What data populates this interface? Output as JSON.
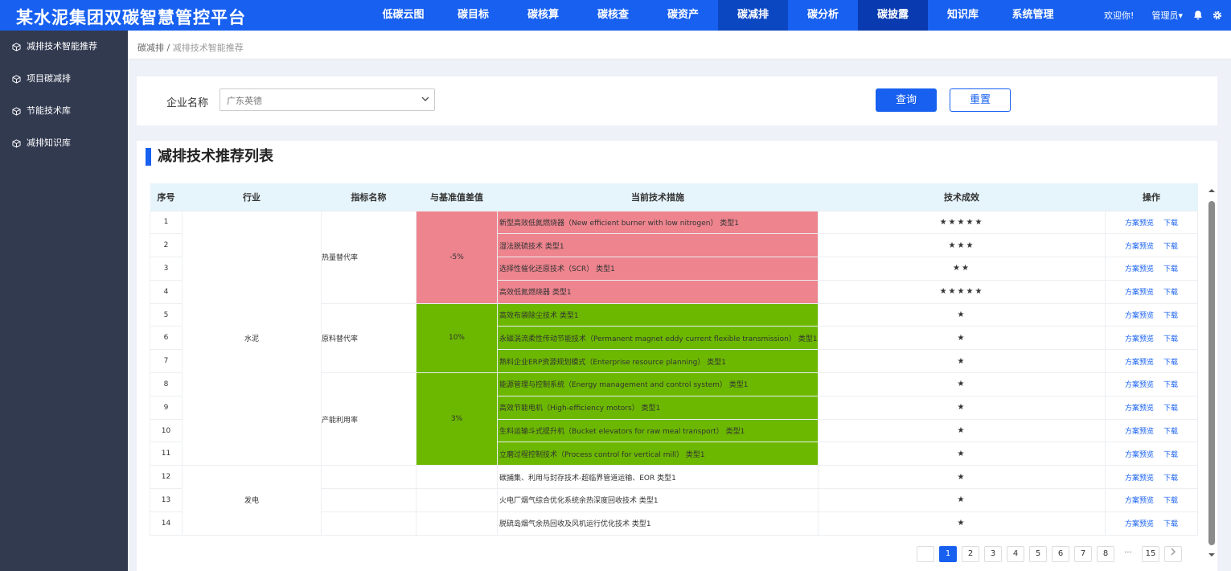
{
  "header": {
    "title": "某水泥集团双碳智慧管控平台",
    "nav": [
      "低碳云图",
      "碳目标",
      "碳核算",
      "碳核查",
      "碳资产",
      "碳减排",
      "碳分析",
      "碳披露",
      "知识库",
      "系统管理"
    ],
    "welcome": "欢迎你!",
    "user": "管理员▾"
  },
  "sidebar": {
    "items": [
      "减排技术智能推荐",
      "项目碳减排",
      "节能技术库",
      "减排知识库"
    ]
  },
  "breadcrumb": {
    "root": "碳减排",
    "sep": "/",
    "current": "减排技术智能推荐"
  },
  "search": {
    "label": "企业名称",
    "value": "广东英德",
    "query": "查询",
    "reset": "重置"
  },
  "list": {
    "title": "减排技术推荐列表",
    "columns": [
      "序号",
      "行业",
      "指标名称",
      "与基准值差值",
      "当前技术措施",
      "技术成效",
      "操作"
    ],
    "rows": [
      {
        "no": "1",
        "measure": "新型高效低氮燃烧器（New efficient burner with low nitrogen） 类型1",
        "stars": 5
      },
      {
        "no": "2",
        "measure": "湿法脱硫技术 类型1",
        "stars": 3
      },
      {
        "no": "3",
        "measure": "选择性催化还原技术（SCR） 类型1",
        "stars": 2
      },
      {
        "no": "4",
        "measure": "高效低氮燃烧器 类型1",
        "stars": 5
      },
      {
        "no": "5",
        "measure": "高效布袋除尘技术 类型1",
        "stars": 1
      },
      {
        "no": "6",
        "measure": "永磁涡流柔性传动节能技术（Permanent magnet eddy current flexible transmission） 类型1",
        "stars": 1
      },
      {
        "no": "7",
        "measure": "熟料企业ERP资源规划模式（Enterprise resource planning） 类型1",
        "stars": 1
      },
      {
        "no": "8",
        "measure": "能源管理与控制系统（Energy management and control system） 类型1",
        "stars": 1
      },
      {
        "no": "9",
        "measure": "高效节能电机（High-efficiency motors） 类型1",
        "stars": 1
      },
      {
        "no": "10",
        "measure": "生料运输斗式提升机（Bucket elevators for raw meal transport） 类型1",
        "stars": 1
      },
      {
        "no": "11",
        "measure": "立磨过程控制技术（Process control for vertical mill） 类型1",
        "stars": 1
      },
      {
        "no": "12",
        "measure": "碳捕集、利用与封存技术-超临界管道运输、EOR 类型1",
        "stars": 1
      },
      {
        "no": "13",
        "measure": "火电厂烟气综合优化系统余热深度回收技术 类型1",
        "stars": 1
      },
      {
        "no": "14",
        "measure": "脱硫岛烟气余热回收及风机运行优化技术 类型1",
        "stars": 1
      }
    ],
    "industries": [
      "水泥",
      "发电"
    ],
    "indicators": [
      "热量替代率",
      "原料替代率",
      "产能利用率"
    ],
    "diffs": [
      "-5%",
      "10%",
      "3%"
    ],
    "ops": {
      "preview": "方案预览",
      "download": "下载"
    }
  },
  "pager": {
    "pages": [
      "1",
      "2",
      "3",
      "4",
      "5",
      "6",
      "7",
      "8",
      "...",
      "15"
    ]
  },
  "colors": {
    "primary": "#1760f0",
    "red": "#ed848e",
    "green": "#6cb800",
    "sidebar": "#323a50"
  }
}
